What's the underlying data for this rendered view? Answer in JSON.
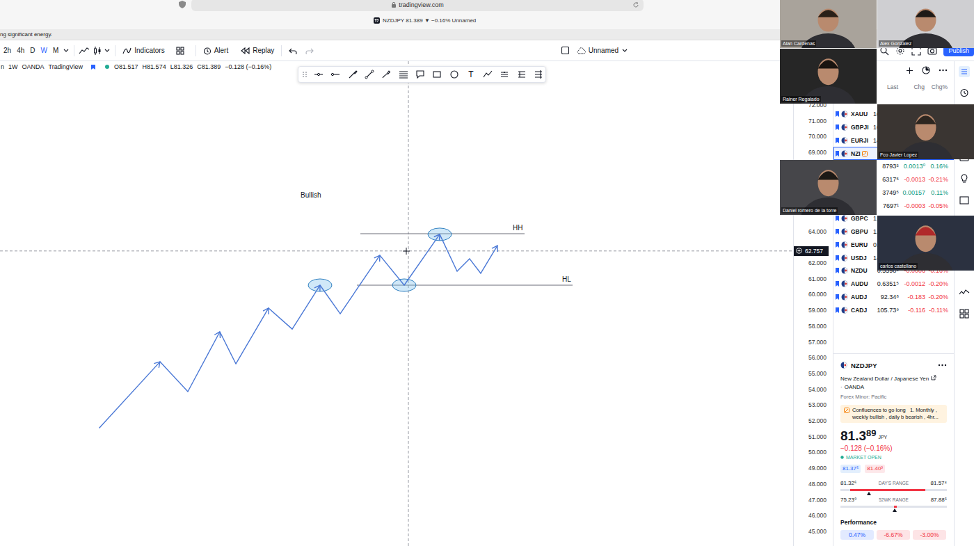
{
  "browser": {
    "url": "tradingview.com",
    "tab_title": "NZDJPY 81.389 ▼ −0.16% Unnamed"
  },
  "notice": "ng significant energy.",
  "toolbar": {
    "intervals": [
      {
        "label": "2h",
        "selected": false
      },
      {
        "label": "4h",
        "selected": false
      },
      {
        "label": "D",
        "selected": false
      },
      {
        "label": "W",
        "selected": true
      },
      {
        "label": "M",
        "selected": false
      }
    ],
    "indicators": "Indicators",
    "alert": "Alert",
    "replay": "Replay",
    "layout": "Unnamed",
    "publish": "Publish"
  },
  "legend": {
    "symbol": "n",
    "interval": "1W",
    "exchange": "OANDA",
    "source": "TradingView",
    "ohlc": [
      {
        "key": "O",
        "value": "81.517"
      },
      {
        "key": "H",
        "value": "81.574"
      },
      {
        "key": "L",
        "value": "81.326"
      },
      {
        "key": "C",
        "value": "81.389"
      }
    ],
    "change": "−0.128 (−0.16%)"
  },
  "drawing_toolbar": {
    "text_tool": "T"
  },
  "chart": {
    "title": "Bullish",
    "series": [
      {
        "values": [
          51.56,
          55.74,
          53.85,
          57.64,
          55.61,
          59.14,
          57.81,
          60.59,
          58.78,
          62.48,
          60.59,
          63.81,
          61.47,
          62.26,
          61.34,
          63.1
        ]
      }
    ],
    "arrow_points": [
      1,
      3,
      5,
      7,
      9,
      11,
      15
    ],
    "marked_points": [
      7,
      10,
      11
    ],
    "levels": [
      {
        "label": "HH",
        "value": 63.85
      },
      {
        "label": "HL",
        "value": 60.59
      }
    ],
    "axis_ticks": [
      "72.000",
      "71.000",
      "70.000",
      "69.000",
      "64.000",
      "62.000",
      "61.000",
      "60.000",
      "59.000",
      "58.000",
      "57.000",
      "56.000",
      "55.000",
      "54.000",
      "53.000",
      "52.000",
      "51.000",
      "50.000",
      "49.000",
      "48.000",
      "47.000",
      "46.000",
      "45.000"
    ],
    "crosshair": {
      "price": "62.757"
    }
  },
  "watchlist": {
    "columns": [
      "Last",
      "Chg",
      "Chg%"
    ],
    "rows": [
      {
        "symbol": "XAUU",
        "last": "16",
        "truncated": true,
        "has_note": false,
        "selected": false
      },
      {
        "symbol": "GBPJI",
        "last": "16",
        "truncated": true,
        "has_note": false,
        "selected": false
      },
      {
        "symbol": "EURJI",
        "last": "14",
        "truncated": true,
        "has_note": false,
        "selected": false
      },
      {
        "symbol": "NZI",
        "truncated": true,
        "has_note": true,
        "selected": true
      },
      {
        "last": "8793⁵",
        "chg": "0.0013⁰",
        "chgp": "0.16%",
        "color": "#089981",
        "truncated": false,
        "has_note": false,
        "selected": false
      },
      {
        "last": "6317⁵",
        "chg": "-0.0013",
        "chgp": "-0.21%",
        "color": "#f23645",
        "truncated": false,
        "has_note": false,
        "selected": false
      },
      {
        "last": "3749⁵",
        "chg": "0.00157",
        "chgp": "0.11%",
        "color": "#089981",
        "truncated": false,
        "has_note": false,
        "selected": false
      },
      {
        "last": "7697¹",
        "chg": "-0.0003",
        "chgp": "-0.05%",
        "color": "#f23645",
        "truncated": false,
        "has_note": false,
        "selected": false
      },
      {
        "symbol": "GBPC",
        "last": "1.",
        "truncated": true,
        "has_note": false,
        "selected": false
      },
      {
        "symbol": "GBPU",
        "last": "1.",
        "truncated": true,
        "has_note": false,
        "selected": false
      },
      {
        "symbol": "EURU",
        "last": "0.",
        "truncated": true,
        "has_note": false,
        "selected": false
      },
      {
        "symbol": "USDJ",
        "last": "14",
        "truncated": true,
        "has_note": false,
        "selected": false
      },
      {
        "symbol": "NZDU",
        "last": "0.5598⁵",
        "chg": "-0.0006",
        "chgp": "-0.16%",
        "color": "#f23645",
        "truncated": false,
        "has_note": false,
        "selected": false
      },
      {
        "symbol": "AUDU",
        "last": "0.6351⁵",
        "chg": "-0.0012",
        "chgp": "-0.20%",
        "color": "#f23645",
        "truncated": false,
        "has_note": false,
        "selected": false
      },
      {
        "symbol": "AUDJ",
        "last": "92.34⁸",
        "chg": "-0.183",
        "chgp": "-0.20%",
        "color": "#f23645",
        "truncated": false,
        "has_note": false,
        "selected": false
      },
      {
        "symbol": "CADJ",
        "last": "105.73⁹",
        "chg": "-0.116",
        "chgp": "-0.11%",
        "color": "#f23645",
        "truncated": false,
        "has_note": false,
        "selected": false
      }
    ]
  },
  "details": {
    "symbol": "NZDJPY",
    "description": "New Zealand Dollar / Japanese Yen",
    "separator": "·",
    "exchange": "OANDA",
    "category": "Forex Minor: Pacific",
    "note": "Confluences to go long   1. Monthly , weekly bullish , daily b bearish , 4hr...",
    "price": "81.3",
    "price_pip": "89",
    "currency": "JPY",
    "change": "−0.128 (−0.16%)",
    "status": "MARKET OPEN",
    "market_open": true,
    "bid": "81.37⁵",
    "ask": "81.40³",
    "ranges": [
      {
        "low": "81.32⁶",
        "label": "DAY'S RANGE",
        "high": "81.57⁴",
        "level": 0.27,
        "band": [
          0.09,
          0.8
        ]
      },
      {
        "low": "75.23⁹",
        "label": "52WK RANGE",
        "high": "87.88⁶",
        "level": 0.51,
        "band": [
          0.5,
          0.53
        ]
      }
    ],
    "performance_title": "Performance",
    "performance": [
      {
        "text": "0.47%",
        "color": "#2962ff"
      },
      {
        "text": "-6.67%",
        "color": "#f23645"
      },
      {
        "text": "-3.00%",
        "color": "#f23645"
      }
    ]
  },
  "participants": [
    {
      "name": "Alan Cardenas"
    },
    {
      "name": "Alex Gonzalez"
    },
    {
      "name": "Rainer Regalado"
    },
    {
      "name": "Fco Javier Lopez"
    },
    {
      "name": "Daniel romero de la torre"
    },
    {
      "name": "carlos castellano"
    }
  ]
}
